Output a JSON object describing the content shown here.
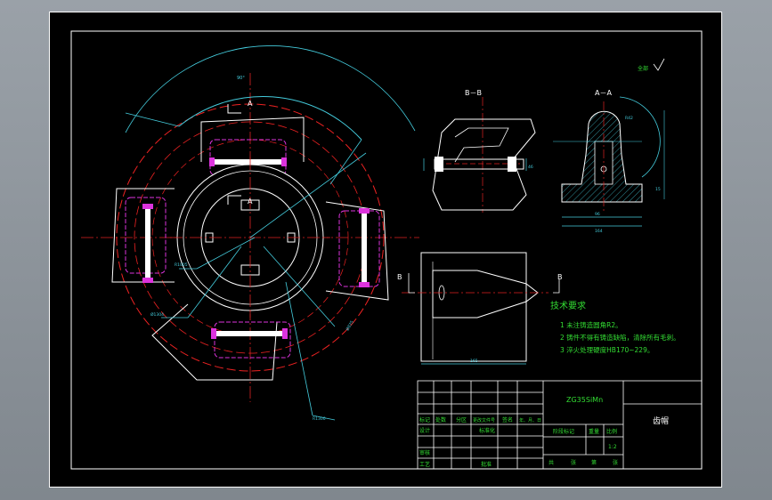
{
  "drawing": {
    "section_bb": "B－B",
    "section_aa": "A－A",
    "marker_a": "A",
    "marker_b": "B",
    "roughness": "全部",
    "dim_top_arc": "90°",
    "dim_r_left": "R1005",
    "dim_d_left": "Ø1304",
    "dim_d_right": "Ø875",
    "dim_bottom": "R1300",
    "dim_bb_w": "56",
    "dim_bb_h": "46",
    "dim_aa_top": "R42",
    "dim_aa_r": "15",
    "dim_aa_base": "96",
    "dim_aa_total": "164",
    "dim_plan": "165"
  },
  "tech": {
    "title": "技术要求",
    "lines": [
      "1 未注铸造圆角R2。",
      "2 铸件不得有铸造缺陷，清除所有毛刺。",
      "3 淬火处理硬度HB170~229。"
    ]
  },
  "titleblock": {
    "material": "ZG35SiMn",
    "part_name": "齿帽",
    "h_mark": "标记",
    "h_count": "处数",
    "h_zone": "分区",
    "h_doc": "更改文件号",
    "h_sign": "签名",
    "h_date": "年、月、日",
    "design": "设计",
    "standardize": "标准化",
    "review": "审核",
    "process": "工艺",
    "approve": "批准",
    "stage": "阶段标记",
    "weight": "重量",
    "scale": "比例",
    "scale_value": "1:2",
    "sheets": "共",
    "sheet_of": "张",
    "sheet_no": "第",
    "sheet_no2": "张"
  }
}
